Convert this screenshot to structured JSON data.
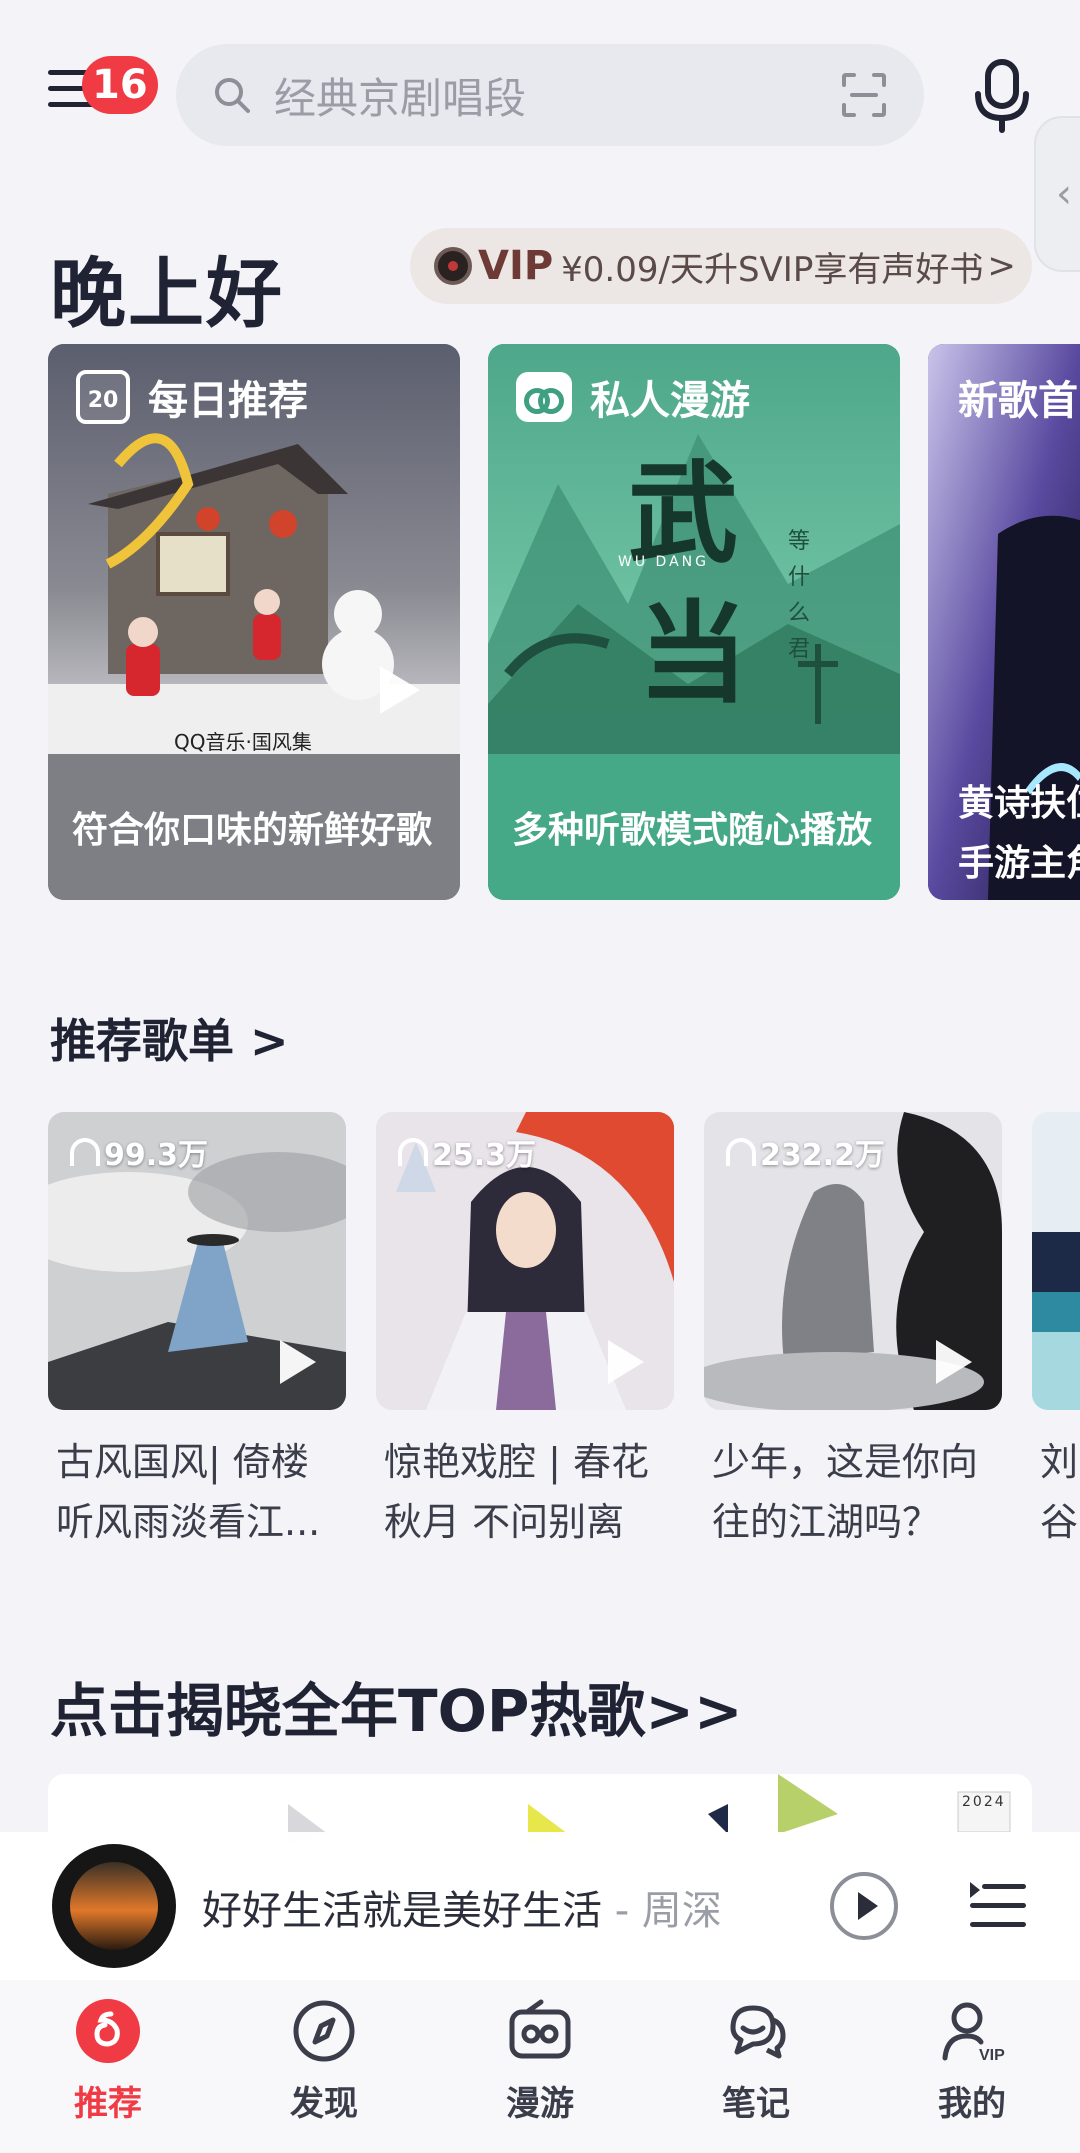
{
  "header": {
    "badge_count": "16",
    "search_placeholder": "经典京剧唱段"
  },
  "greeting": {
    "text": "晚上好",
    "vip_word": "VIP",
    "vip_promo": "¥0.09/天升SVIP享有声好书",
    "vip_arrow": ">"
  },
  "feature_cards": [
    {
      "title": "每日推荐",
      "calendar_day": "20",
      "caption": "符合你口味的新鲜好歌",
      "brand": "QQ音乐·国风集"
    },
    {
      "title": "私人漫游",
      "caption": "多种听歌模式随心播放",
      "art_text_1": "武",
      "art_text_2": "当",
      "art_text_3": "WU DANG",
      "art_text_4": "等什么君"
    },
    {
      "title": "新歌首",
      "caption_1": "黄诗扶位",
      "caption_2": "手游主角"
    }
  ],
  "playlists_section": {
    "title": "推荐歌单 >"
  },
  "playlists": [
    {
      "plays": "99.3万",
      "title": "古风国风| 倚楼听风雨淡看江..."
    },
    {
      "plays": "25.3万",
      "title": "惊艳戏腔 | 春花秋月 不问别离"
    },
    {
      "plays": "232.2万",
      "title": "少年，这是你向往的江湖吗？"
    },
    {
      "plays": "",
      "title": "刘谷"
    }
  ],
  "top_banner": {
    "title": "点击揭晓全年TOP热歌>>",
    "year_badge": "2024"
  },
  "player": {
    "song": "好好生活就是美好生活",
    "artist": " - 周深"
  },
  "nav": [
    {
      "label": "推荐",
      "icon": "netease-logo-icon",
      "active": true
    },
    {
      "label": "发现",
      "icon": "compass-icon",
      "active": false
    },
    {
      "label": "漫游",
      "icon": "radio-icon",
      "active": false
    },
    {
      "label": "笔记",
      "icon": "chat-bubbles-icon",
      "active": false
    },
    {
      "label": "我的",
      "icon": "user-vip-icon",
      "active": false
    }
  ],
  "colors": {
    "accent_red": "#f03a44",
    "background": "#f4f4f8",
    "card_gray": "#7d7f84",
    "card_green": "#45a887",
    "card_purple": "#3a2f6e"
  }
}
